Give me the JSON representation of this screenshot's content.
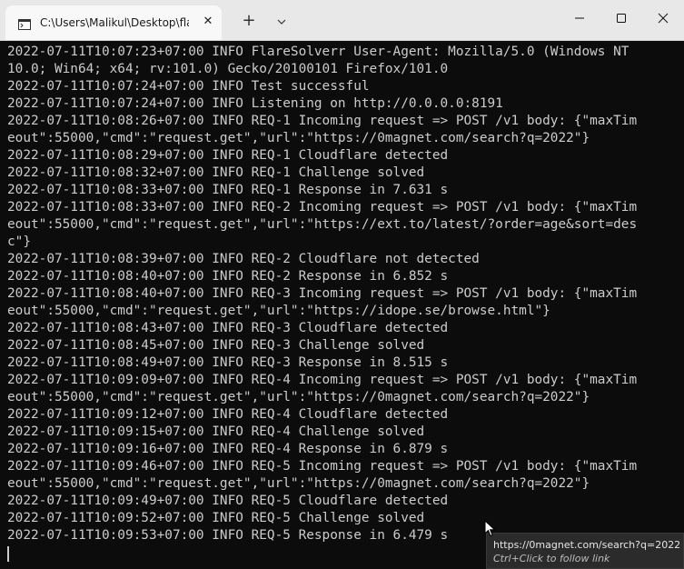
{
  "window": {
    "tab_title": "C:\\Users\\Malikul\\Desktop\\flaresolverr.exe",
    "tab_close_glyph": "✕",
    "new_tab_glyph": "+"
  },
  "console": {
    "lines": [
      "2022-07-11T10:07:23+07:00 INFO FlareSolverr User-Agent: Mozilla/5.0 (Windows NT",
      "10.0; Win64; x64; rv:101.0) Gecko/20100101 Firefox/101.0",
      "2022-07-11T10:07:24+07:00 INFO Test successful",
      "2022-07-11T10:07:24+07:00 INFO Listening on http://0.0.0.0:8191",
      "2022-07-11T10:08:26+07:00 INFO REQ-1 Incoming request => POST /v1 body: {\"maxTim",
      "eout\":55000,\"cmd\":\"request.get\",\"url\":\"https://0magnet.com/search?q=2022\"}",
      "2022-07-11T10:08:29+07:00 INFO REQ-1 Cloudflare detected",
      "2022-07-11T10:08:32+07:00 INFO REQ-1 Challenge solved",
      "2022-07-11T10:08:33+07:00 INFO REQ-1 Response in 7.631 s",
      "2022-07-11T10:08:33+07:00 INFO REQ-2 Incoming request => POST /v1 body: {\"maxTim",
      "eout\":55000,\"cmd\":\"request.get\",\"url\":\"https://ext.to/latest/?order=age&sort=des",
      "c\"}",
      "2022-07-11T10:08:39+07:00 INFO REQ-2 Cloudflare not detected",
      "2022-07-11T10:08:40+07:00 INFO REQ-2 Response in 6.852 s",
      "2022-07-11T10:08:40+07:00 INFO REQ-3 Incoming request => POST /v1 body: {\"maxTim",
      "eout\":55000,\"cmd\":\"request.get\",\"url\":\"https://idope.se/browse.html\"}",
      "2022-07-11T10:08:43+07:00 INFO REQ-3 Cloudflare detected",
      "2022-07-11T10:08:45+07:00 INFO REQ-3 Challenge solved",
      "2022-07-11T10:08:49+07:00 INFO REQ-3 Response in 8.515 s",
      "2022-07-11T10:09:09+07:00 INFO REQ-4 Incoming request => POST /v1 body: {\"maxTim",
      "eout\":55000,\"cmd\":\"request.get\",\"url\":\"https://0magnet.com/search?q=2022\"}",
      "2022-07-11T10:09:12+07:00 INFO REQ-4 Cloudflare detected",
      "2022-07-11T10:09:15+07:00 INFO REQ-4 Challenge solved",
      "2022-07-11T10:09:16+07:00 INFO REQ-4 Response in 6.879 s",
      "2022-07-11T10:09:46+07:00 INFO REQ-5 Incoming request => POST /v1 body: {\"maxTim",
      "eout\":55000,\"cmd\":\"request.get\",\"url\":\"https://0magnet.com/search?q=2022\"}",
      "2022-07-11T10:09:49+07:00 INFO REQ-5 Cloudflare detected",
      "2022-07-11T10:09:52+07:00 INFO REQ-5 Challenge solved",
      "2022-07-11T10:09:53+07:00 INFO REQ-5 Response in 6.479 s"
    ]
  },
  "tooltip": {
    "url": "https://0magnet.com/search?q=2022",
    "hint": "Ctrl+Click to follow link"
  },
  "colors": {
    "console_bg": "#0c0c0c",
    "console_fg": "#cccccc",
    "titlebar_bg": "#e8e8e8",
    "tab_bg": "#f8f8f8",
    "tooltip_bg": "#2b2b2b"
  },
  "icons": {
    "tab": "terminal-icon",
    "dropdown": "chevron-down-icon",
    "minimize": "minimize-icon",
    "maximize": "maximize-icon",
    "close": "close-icon"
  }
}
